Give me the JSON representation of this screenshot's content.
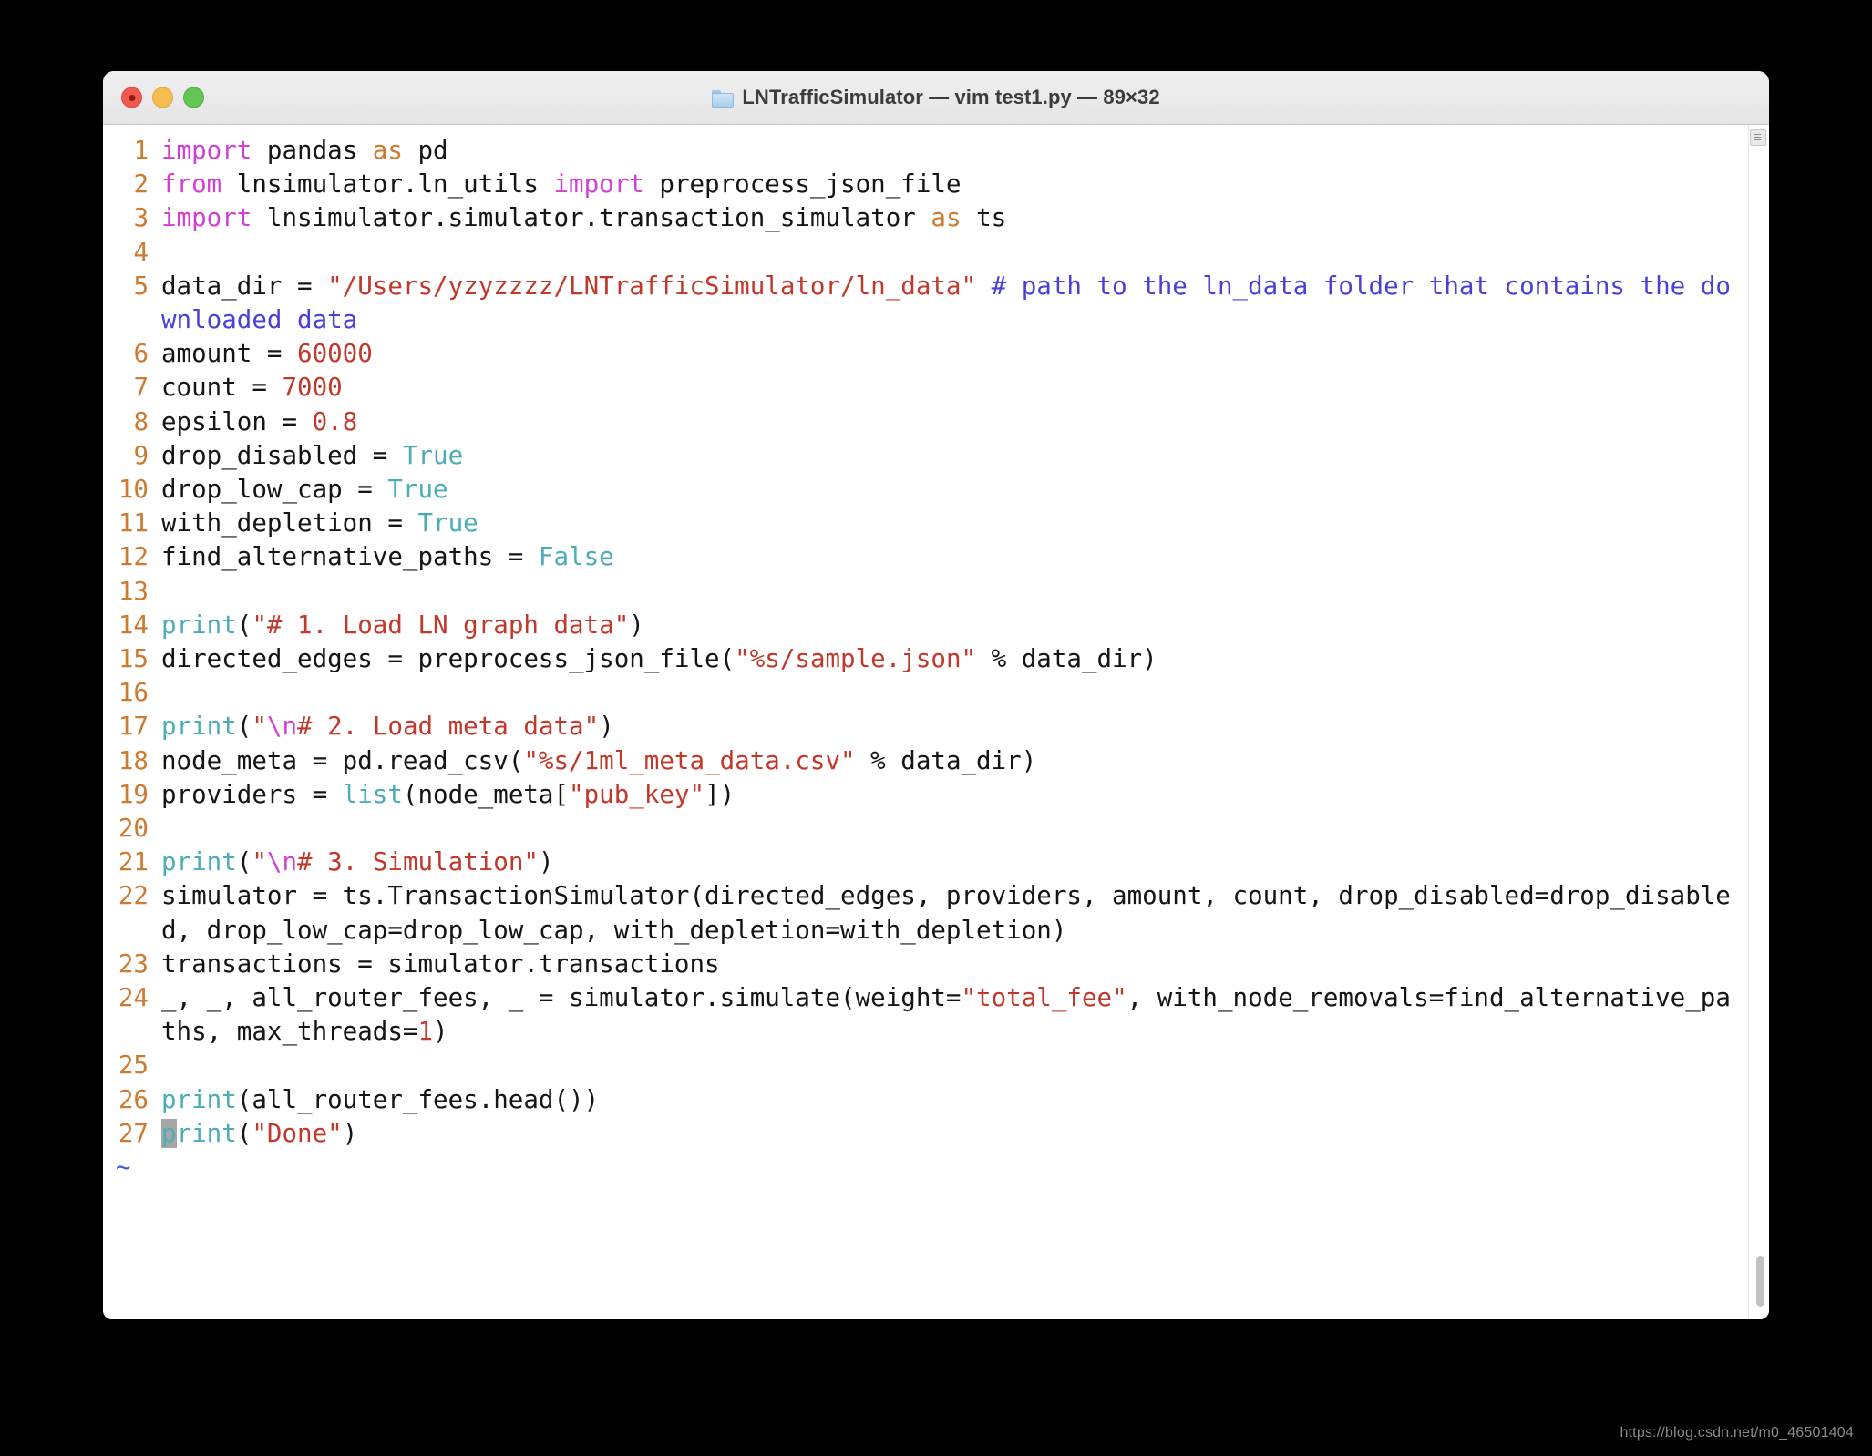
{
  "window": {
    "title": "LNTrafficSimulator — vim test1.py — 89×32",
    "folder_icon": "folder-icon",
    "traffic_lights": {
      "close": "close",
      "minimize": "minimize",
      "zoom": "zoom"
    }
  },
  "editor": {
    "app": "vim",
    "filename": "test1.py",
    "terminal_size": "89×32",
    "tilde_marker": "~",
    "cursor": {
      "line": 27,
      "column": 1,
      "char": "p"
    },
    "lines": [
      {
        "n": "1",
        "tokens": [
          {
            "t": "import",
            "c": "kw"
          },
          {
            "t": " pandas ",
            "c": "plain"
          },
          {
            "t": "as",
            "c": "op"
          },
          {
            "t": " pd",
            "c": "plain"
          }
        ]
      },
      {
        "n": "2",
        "tokens": [
          {
            "t": "from",
            "c": "kw"
          },
          {
            "t": " lnsimulator.ln_utils ",
            "c": "plain"
          },
          {
            "t": "import",
            "c": "kw"
          },
          {
            "t": " preprocess_json_file",
            "c": "plain"
          }
        ]
      },
      {
        "n": "3",
        "tokens": [
          {
            "t": "import",
            "c": "kw"
          },
          {
            "t": " lnsimulator.simulator.transaction_simulator ",
            "c": "plain"
          },
          {
            "t": "as",
            "c": "op"
          },
          {
            "t": " ts",
            "c": "plain"
          }
        ]
      },
      {
        "n": "4",
        "tokens": []
      },
      {
        "n": "5",
        "tokens": [
          {
            "t": "data_dir = ",
            "c": "plain"
          },
          {
            "t": "\"/Users/yzyzzzz/LNTrafficSimulator/ln_data\"",
            "c": "str"
          },
          {
            "t": " ",
            "c": "plain"
          },
          {
            "t": "# path to the ln_data folder that contains the downloaded data",
            "c": "cmt"
          }
        ]
      },
      {
        "n": "6",
        "tokens": [
          {
            "t": "amount = ",
            "c": "plain"
          },
          {
            "t": "60000",
            "c": "num"
          }
        ]
      },
      {
        "n": "7",
        "tokens": [
          {
            "t": "count = ",
            "c": "plain"
          },
          {
            "t": "7000",
            "c": "num"
          }
        ]
      },
      {
        "n": "8",
        "tokens": [
          {
            "t": "epsilon = ",
            "c": "plain"
          },
          {
            "t": "0.8",
            "c": "num"
          }
        ]
      },
      {
        "n": "9",
        "tokens": [
          {
            "t": "drop_disabled = ",
            "c": "plain"
          },
          {
            "t": "True",
            "c": "bool"
          }
        ]
      },
      {
        "n": "10",
        "tokens": [
          {
            "t": "drop_low_cap = ",
            "c": "plain"
          },
          {
            "t": "True",
            "c": "bool"
          }
        ]
      },
      {
        "n": "11",
        "tokens": [
          {
            "t": "with_depletion = ",
            "c": "plain"
          },
          {
            "t": "True",
            "c": "bool"
          }
        ]
      },
      {
        "n": "12",
        "tokens": [
          {
            "t": "find_alternative_paths = ",
            "c": "plain"
          },
          {
            "t": "False",
            "c": "bool"
          }
        ]
      },
      {
        "n": "13",
        "tokens": []
      },
      {
        "n": "14",
        "tokens": [
          {
            "t": "print",
            "c": "fn"
          },
          {
            "t": "(",
            "c": "plain"
          },
          {
            "t": "\"# 1. Load LN graph data\"",
            "c": "str"
          },
          {
            "t": ")",
            "c": "plain"
          }
        ]
      },
      {
        "n": "15",
        "tokens": [
          {
            "t": "directed_edges = preprocess_json_file(",
            "c": "plain"
          },
          {
            "t": "\"%s/sample.json\"",
            "c": "str"
          },
          {
            "t": " % data_dir)",
            "c": "plain"
          }
        ]
      },
      {
        "n": "16",
        "tokens": []
      },
      {
        "n": "17",
        "tokens": [
          {
            "t": "print",
            "c": "fn"
          },
          {
            "t": "(",
            "c": "plain"
          },
          {
            "t": "\"",
            "c": "str"
          },
          {
            "t": "\\n",
            "c": "esc"
          },
          {
            "t": "# 2. Load meta data\"",
            "c": "str"
          },
          {
            "t": ")",
            "c": "plain"
          }
        ]
      },
      {
        "n": "18",
        "tokens": [
          {
            "t": "node_meta = pd.read_csv(",
            "c": "plain"
          },
          {
            "t": "\"%s/1ml_meta_data.csv\"",
            "c": "str"
          },
          {
            "t": " % data_dir)",
            "c": "plain"
          }
        ]
      },
      {
        "n": "19",
        "tokens": [
          {
            "t": "providers = ",
            "c": "plain"
          },
          {
            "t": "list",
            "c": "fn"
          },
          {
            "t": "(node_meta[",
            "c": "plain"
          },
          {
            "t": "\"pub_key\"",
            "c": "str"
          },
          {
            "t": "])",
            "c": "plain"
          }
        ]
      },
      {
        "n": "20",
        "tokens": []
      },
      {
        "n": "21",
        "tokens": [
          {
            "t": "print",
            "c": "fn"
          },
          {
            "t": "(",
            "c": "plain"
          },
          {
            "t": "\"",
            "c": "str"
          },
          {
            "t": "\\n",
            "c": "esc"
          },
          {
            "t": "# 3. Simulation\"",
            "c": "str"
          },
          {
            "t": ")",
            "c": "plain"
          }
        ]
      },
      {
        "n": "22",
        "tokens": [
          {
            "t": "simulator = ts.TransactionSimulator(directed_edges, providers, amount, count, drop_disabled=drop_disabled, drop_low_cap=drop_low_cap, with_depletion=with_depletion)",
            "c": "plain"
          }
        ]
      },
      {
        "n": "23",
        "tokens": [
          {
            "t": "transactions = simulator.transactions",
            "c": "plain"
          }
        ]
      },
      {
        "n": "24",
        "tokens": [
          {
            "t": "_, _, all_router_fees, _ = simulator.simulate(weight=",
            "c": "plain"
          },
          {
            "t": "\"total_fee\"",
            "c": "str"
          },
          {
            "t": ", with_node_removals=find_alternative_paths, max_threads=",
            "c": "plain"
          },
          {
            "t": "1",
            "c": "num"
          },
          {
            "t": ")",
            "c": "plain"
          }
        ]
      },
      {
        "n": "25",
        "tokens": []
      },
      {
        "n": "26",
        "tokens": [
          {
            "t": "print",
            "c": "fn"
          },
          {
            "t": "(all_router_fees.head())",
            "c": "plain"
          }
        ]
      },
      {
        "n": "27",
        "tokens": [
          {
            "t": "p",
            "c": "fn cursor"
          },
          {
            "t": "rint",
            "c": "fn"
          },
          {
            "t": "(",
            "c": "plain"
          },
          {
            "t": "\"Done\"",
            "c": "str"
          },
          {
            "t": ")",
            "c": "plain"
          }
        ]
      }
    ]
  },
  "scrollbar": {
    "top_button": "scroll-options-icon",
    "thumb": "scroll-thumb"
  },
  "watermark": "https://blog.csdn.net/m0_46501404",
  "colors": {
    "keyword": "#d23fd2",
    "operator": "#cb7b32",
    "string": "#c0392b",
    "number": "#c0392b",
    "comment": "#4b3fd6",
    "boolean": "#4cacb8",
    "builtin": "#4cacb8",
    "linenumber": "#cb7b32",
    "text": "#151515",
    "background": "#ffffff",
    "cursor": "#a6a6a6",
    "tilde": "#3f5bd6"
  }
}
